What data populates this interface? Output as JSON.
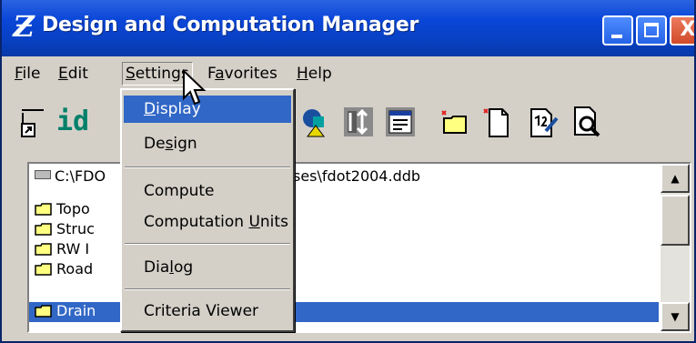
{
  "window": {
    "title": "Design and Computation Manager",
    "app_icon_glyph": "Ƶ",
    "controls": [
      "minimize",
      "maximize",
      "close"
    ],
    "close_glyph": "X",
    "colors": {
      "titlebar": "#0a46d8",
      "selection": "#3167c6",
      "face": "#d4d0c8"
    }
  },
  "menubar": {
    "items": [
      {
        "label_pre": "",
        "label_ul": "F",
        "label_post": "ile"
      },
      {
        "label_pre": "",
        "label_ul": "E",
        "label_post": "dit"
      },
      {
        "label_pre": "",
        "label_ul": "S",
        "label_post": "ettings"
      },
      {
        "label_pre": "F",
        "label_ul": "a",
        "label_post": "vorites"
      },
      {
        "label_pre": "",
        "label_ul": "H",
        "label_post": "elp"
      }
    ]
  },
  "toolbar": {
    "id_label": "id",
    "icons": [
      "folder-open-icon",
      "id-icon",
      "shapes-icon",
      "move-items-icon",
      "properties-icon",
      "new-folder-icon",
      "new-document-icon",
      "rename-icon",
      "print-preview-icon"
    ]
  },
  "settings_menu": {
    "items": [
      {
        "pre": "",
        "ul": "D",
        "post": "isplay",
        "highlighted": true
      },
      {
        "pre": "De",
        "ul": "s",
        "post": "ign",
        "highlighted": false
      },
      {
        "pre": "Compute",
        "ul": "",
        "post": "",
        "highlighted": false
      },
      {
        "pre": "Computation ",
        "ul": "U",
        "post": "nits",
        "highlighted": false
      },
      {
        "pre": "Dia",
        "ul": "l",
        "post": "og",
        "highlighted": false
      },
      {
        "pre": "Criteria Viewer",
        "ul": "",
        "post": "",
        "highlighted": false
      }
    ]
  },
  "tree": {
    "root_path_visible": "C:\\FDO",
    "root_path_tail": "ses\\fdot2004.ddb",
    "folders": [
      {
        "label": "Topo",
        "selected": false
      },
      {
        "label": "Struc",
        "selected": false
      },
      {
        "label": "RW I",
        "selected": false
      },
      {
        "label": "Road",
        "selected": false
      },
      {
        "label": "Drain",
        "selected": true
      }
    ]
  },
  "scrollbar": {
    "up_glyph": "▲",
    "down_glyph": "▼"
  }
}
